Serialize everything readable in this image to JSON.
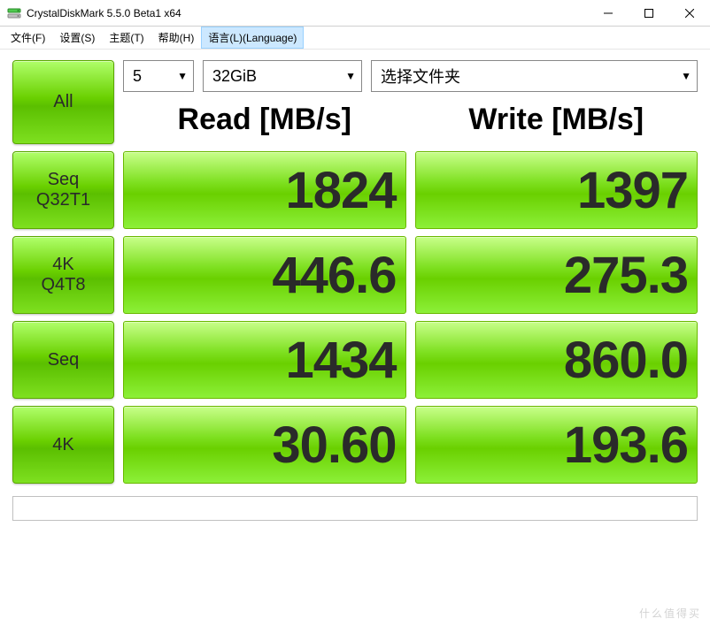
{
  "window": {
    "title": "CrystalDiskMark 5.5.0 Beta1 x64"
  },
  "menu": {
    "file": "文件(F)",
    "settings": "设置(S)",
    "theme": "主题(T)",
    "help": "帮助(H)",
    "language": "语言(L)(Language)"
  },
  "controls": {
    "runs": "5",
    "size": "32GiB",
    "folder": "选择文件夹"
  },
  "headers": {
    "read": "Read [MB/s]",
    "write": "Write [MB/s]"
  },
  "buttons": {
    "all": "All",
    "seq_q32t1": "Seq\nQ32T1",
    "k4_q4t8": "4K\nQ4T8",
    "seq": "Seq",
    "k4": "4K"
  },
  "results": {
    "seq_q32t1": {
      "read": "1824",
      "write": "1397"
    },
    "k4_q4t8": {
      "read": "446.6",
      "write": "275.3"
    },
    "seq": {
      "read": "1434",
      "write": "860.0"
    },
    "k4": {
      "read": "30.60",
      "write": "193.6"
    }
  },
  "watermark": "什么值得买"
}
